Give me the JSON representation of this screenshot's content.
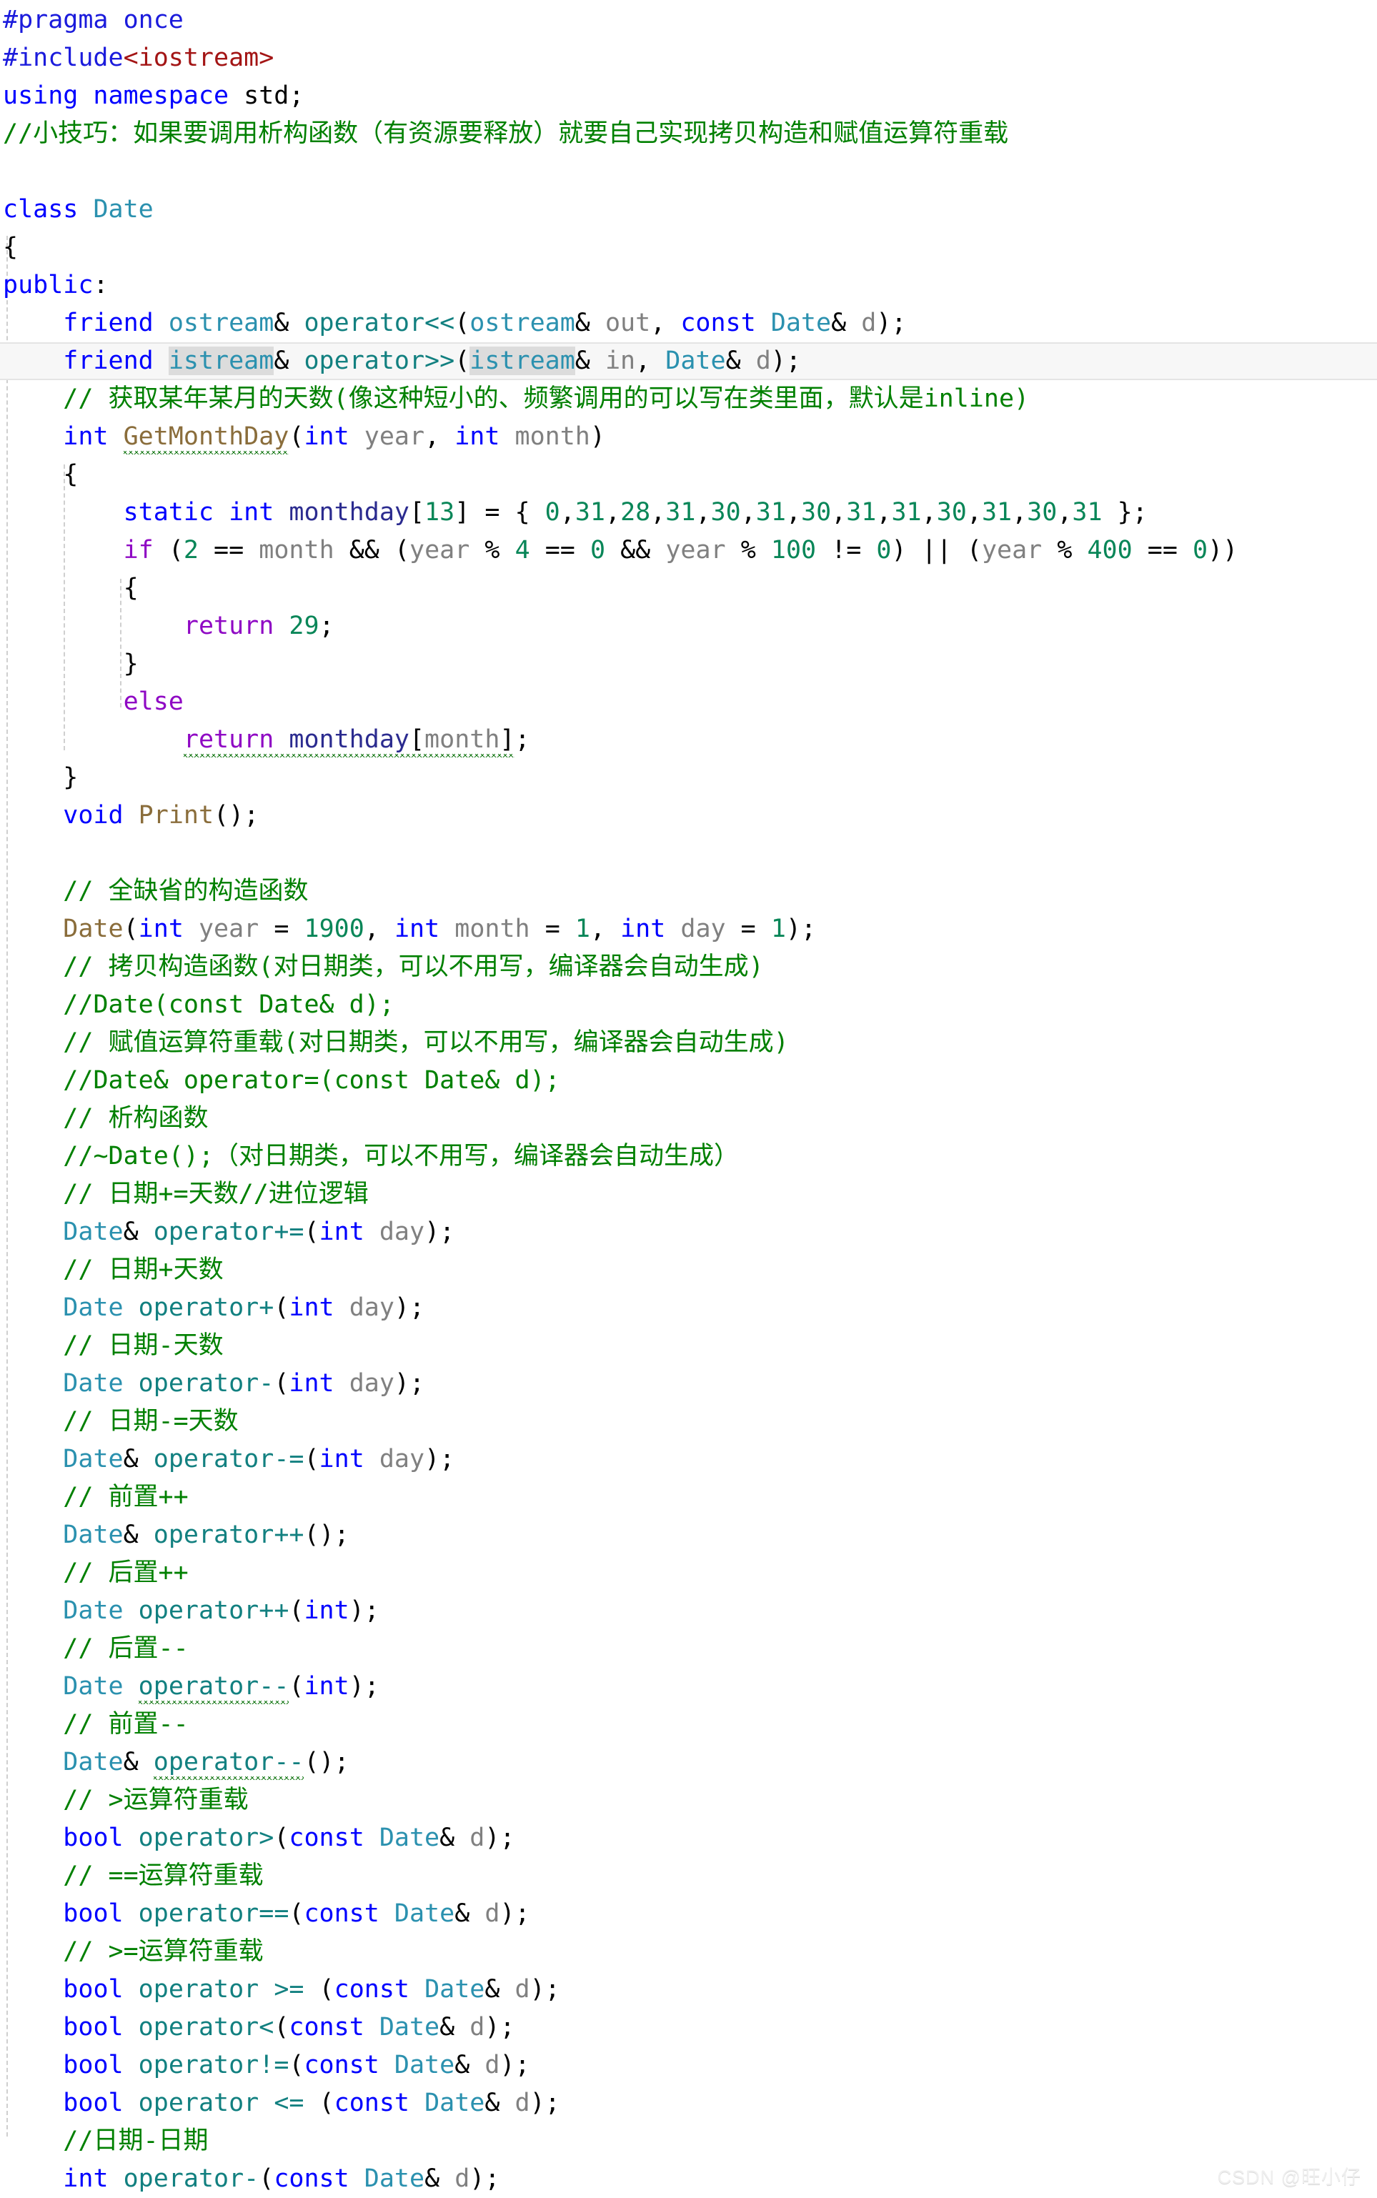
{
  "app": {
    "kind": "code-editor",
    "language": "C++",
    "theme": "light"
  },
  "watermark": {
    "text": "CSDN @旺小仔"
  },
  "colors": {
    "background": "#ffffff",
    "keyword": "#0000ff",
    "preprocessor": "#1b1bdc",
    "string": "#a31515",
    "comment": "#008000",
    "type": "#2b91af",
    "function": "#8a6d3b",
    "operator": "#128080",
    "number": "#098658",
    "control": "#8f08c4",
    "identifier": "#808080",
    "punctuation": "#000000",
    "match_highlight": "#dcdcdc",
    "current_line_background": "#f7f7f7",
    "current_line_border": "#e4e4e4",
    "indent_guide": "#cfcfcf",
    "squiggle": "#1a7a1a",
    "watermark": "#efefef"
  },
  "code": {
    "lines": [
      {
        "id": 1,
        "text": "#pragma once"
      },
      {
        "id": 2,
        "text": "#include<iostream>"
      },
      {
        "id": 3,
        "text": "using namespace std;"
      },
      {
        "id": 4,
        "text": "//小技巧：如果要调用析构函数（有资源要释放）就要自己实现拷贝构造和赋值运算符重载"
      },
      {
        "id": 5,
        "text": ""
      },
      {
        "id": 6,
        "text": "class Date"
      },
      {
        "id": 7,
        "text": "{"
      },
      {
        "id": 8,
        "text": "public:"
      },
      {
        "id": 9,
        "text": "    friend ostream& operator<<(ostream& out, const Date& d);"
      },
      {
        "id": 10,
        "text": "    friend istream& operator>>(istream& in, Date& d);",
        "current": true
      },
      {
        "id": 11,
        "text": "    // 获取某年某月的天数(像这种短小的、频繁调用的可以写在类里面，默认是inline)"
      },
      {
        "id": 12,
        "text": "    int GetMonthDay(int year, int month)"
      },
      {
        "id": 13,
        "text": "    {"
      },
      {
        "id": 14,
        "text": "        static int monthday[13] = { 0,31,28,31,30,31,30,31,31,30,31,30,31 };"
      },
      {
        "id": 15,
        "text": "        if (2 == month && (year % 4 == 0 && year % 100 != 0) || (year % 400 == 0))"
      },
      {
        "id": 16,
        "text": "        {"
      },
      {
        "id": 17,
        "text": "            return 29;"
      },
      {
        "id": 18,
        "text": "        }"
      },
      {
        "id": 19,
        "text": "        else"
      },
      {
        "id": 20,
        "text": "            return monthday[month];"
      },
      {
        "id": 21,
        "text": "    }"
      },
      {
        "id": 22,
        "text": "    void Print();"
      },
      {
        "id": 23,
        "text": ""
      },
      {
        "id": 24,
        "text": "    // 全缺省的构造函数"
      },
      {
        "id": 25,
        "text": "    Date(int year = 1900, int month = 1, int day = 1);"
      },
      {
        "id": 26,
        "text": "    // 拷贝构造函数(对日期类，可以不用写，编译器会自动生成)"
      },
      {
        "id": 27,
        "text": "    //Date(const Date& d);"
      },
      {
        "id": 28,
        "text": "    // 赋值运算符重载(对日期类，可以不用写，编译器会自动生成)"
      },
      {
        "id": 29,
        "text": "    //Date& operator=(const Date& d);"
      },
      {
        "id": 30,
        "text": "    // 析构函数"
      },
      {
        "id": 31,
        "text": "    //~Date();（对日期类，可以不用写，编译器会自动生成）"
      },
      {
        "id": 32,
        "text": "    // 日期+=天数//进位逻辑"
      },
      {
        "id": 33,
        "text": "    Date& operator+=(int day);"
      },
      {
        "id": 34,
        "text": "    // 日期+天数"
      },
      {
        "id": 35,
        "text": "    Date operator+(int day);"
      },
      {
        "id": 36,
        "text": "    // 日期-天数"
      },
      {
        "id": 37,
        "text": "    Date operator-(int day);"
      },
      {
        "id": 38,
        "text": "    // 日期-=天数"
      },
      {
        "id": 39,
        "text": "    Date& operator-=(int day);"
      },
      {
        "id": 40,
        "text": "    // 前置++"
      },
      {
        "id": 41,
        "text": "    Date& operator++();"
      },
      {
        "id": 42,
        "text": "    // 后置++"
      },
      {
        "id": 43,
        "text": "    Date operator++(int);"
      },
      {
        "id": 44,
        "text": "    // 后置--"
      },
      {
        "id": 45,
        "text": "    Date operator--(int);"
      },
      {
        "id": 46,
        "text": "    // 前置--"
      },
      {
        "id": 47,
        "text": "    Date& operator--();"
      },
      {
        "id": 48,
        "text": "    // >运算符重载"
      },
      {
        "id": 49,
        "text": "    bool operator>(const Date& d);"
      },
      {
        "id": 50,
        "text": "    // ==运算符重载"
      },
      {
        "id": 51,
        "text": "    bool operator==(const Date& d);"
      },
      {
        "id": 52,
        "text": "    // >=运算符重载"
      },
      {
        "id": 53,
        "text": "    bool operator >= (const Date& d);"
      },
      {
        "id": 54,
        "text": "    bool operator<(const Date& d);"
      },
      {
        "id": 55,
        "text": "    bool operator!=(const Date& d);"
      },
      {
        "id": 56,
        "text": "    bool operator <= (const Date& d);"
      },
      {
        "id": 57,
        "text": "    //日期-日期"
      },
      {
        "id": 58,
        "text": "    int operator-(const Date& d);"
      }
    ]
  }
}
